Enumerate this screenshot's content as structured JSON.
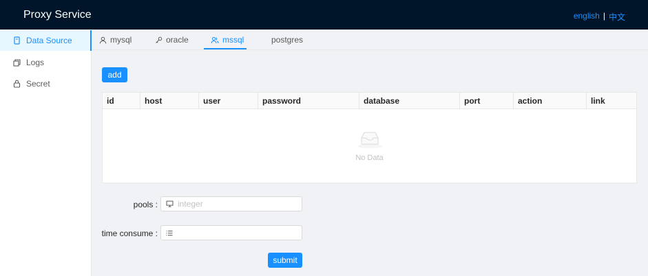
{
  "header": {
    "title": "Proxy Service",
    "lang_english": "english",
    "lang_separator": "|",
    "lang_chinese": "中文"
  },
  "sidebar": {
    "items": [
      {
        "label": "Data Source",
        "icon": "database-icon",
        "selected": true
      },
      {
        "label": "Logs",
        "icon": "logs-icon",
        "selected": false
      },
      {
        "label": "Secret",
        "icon": "lock-icon",
        "selected": false
      }
    ]
  },
  "tabs": [
    {
      "label": "mysql",
      "icon": "user-icon",
      "active": false
    },
    {
      "label": "oracle",
      "icon": "key-icon",
      "active": false
    },
    {
      "label": "mssql",
      "icon": "team-icon",
      "active": true
    },
    {
      "label": "postgres",
      "icon": "",
      "active": false
    }
  ],
  "toolbar": {
    "add_label": "add"
  },
  "table": {
    "columns": [
      "id",
      "host",
      "user",
      "password",
      "database",
      "port",
      "action",
      "link"
    ],
    "rows": [],
    "empty_text": "No Data"
  },
  "form": {
    "pools_label": "pools :",
    "pools_placeholder": "integer",
    "pools_icon": "desktop-icon",
    "time_consume_label": "time consume :",
    "time_consume_value": "",
    "time_consume_icon": "list-icon",
    "submit_label": "submit"
  },
  "colors": {
    "header_bg": "#001529",
    "accent": "#1890ff",
    "content_bg": "#f0f2f5"
  }
}
